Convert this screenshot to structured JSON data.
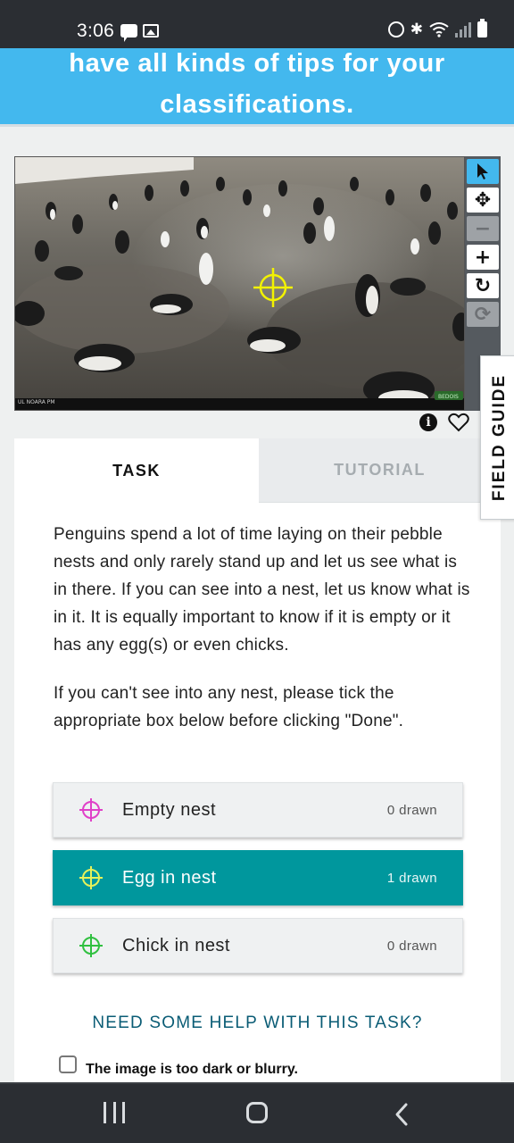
{
  "status_bar": {
    "time": "3:06",
    "icons": [
      "chat-icon",
      "image-icon",
      "alarm-icon",
      "bluetooth-icon",
      "wifi-icon",
      "signal-icon",
      "battery-icon"
    ]
  },
  "banner": {
    "line1": "have all kinds of tips for your",
    "line2": "classifications."
  },
  "subject": {
    "watermark_left": "UL NOARA PM",
    "watermark_right": "BEDOIS"
  },
  "toolbar": {
    "tools": [
      "pointer-icon",
      "move-icon",
      "zoom-out-icon",
      "zoom-in-icon",
      "rotate-icon",
      "reset-icon"
    ]
  },
  "field_guide": {
    "label": "FIELD GUIDE"
  },
  "tabs": {
    "task": "TASK",
    "tutorial": "TUTORIAL"
  },
  "instructions": {
    "paragraph1": "Penguins spend a lot of time laying on their pebble nests and only rarely stand up and let us see what is in there. If you can see into a nest, let us know what is in it. It is equally important to know if it is empty or it has any egg(s) or even chicks.",
    "paragraph2": "If you can't see into any nest, please tick the appropriate box below before clicking \"Done\"."
  },
  "choices": [
    {
      "label": "Empty nest",
      "count": "0 drawn",
      "color": "#e040c8",
      "selected": false
    },
    {
      "label": "Egg in nest",
      "count": "1 drawn",
      "color": "#e6f25a",
      "selected": true
    },
    {
      "label": "Chick in nest",
      "count": "0 drawn",
      "color": "#30c040",
      "selected": false
    }
  ],
  "help_link": "NEED SOME HELP WITH THIS TASK?",
  "checkbox": {
    "label": "The image is too dark or blurry.",
    "checked": false
  },
  "colors": {
    "banner": "#43b8ee",
    "selected_choice": "#00979d",
    "help_link": "#0a5c75",
    "marker": "#f2f200"
  }
}
